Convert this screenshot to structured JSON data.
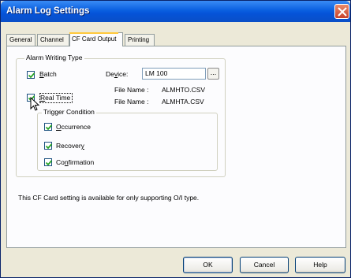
{
  "window": {
    "title": "Alarm Log Settings"
  },
  "tabs": [
    {
      "label": "General"
    },
    {
      "label": "Channel"
    },
    {
      "label": "CF Card Output"
    },
    {
      "label": "Printing"
    }
  ],
  "alarm_writing_type": {
    "legend": "Alarm Writing Type",
    "batch": {
      "label_u": "B",
      "label_rest": "atch",
      "checked": true
    },
    "device": {
      "label_a": "De",
      "label_u": "v",
      "label_b": "ice:",
      "value": "LM 100",
      "browse_label": "..."
    },
    "file_name_1": {
      "label": "File Name :",
      "value": "ALMHTO.CSV"
    },
    "real_time": {
      "label_u": "R",
      "label_rest": "eal Time",
      "checked": true
    },
    "file_name_2": {
      "label": "File Name :",
      "value": "ALMHTA.CSV"
    }
  },
  "trigger_condition": {
    "legend": "Trigger Condition",
    "occurrence": {
      "label_u": "O",
      "label_rest": "ccurrence",
      "checked": true
    },
    "recovery": {
      "label_a": "Recover",
      "label_u": "y",
      "checked": true
    },
    "confirmation": {
      "label_a": "Co",
      "label_u": "n",
      "label_b": "firmation",
      "checked": true
    }
  },
  "note": "This CF Card setting is available for only supporting O/I type.",
  "buttons": {
    "ok": "OK",
    "cancel": "Cancel",
    "help": "Help"
  }
}
